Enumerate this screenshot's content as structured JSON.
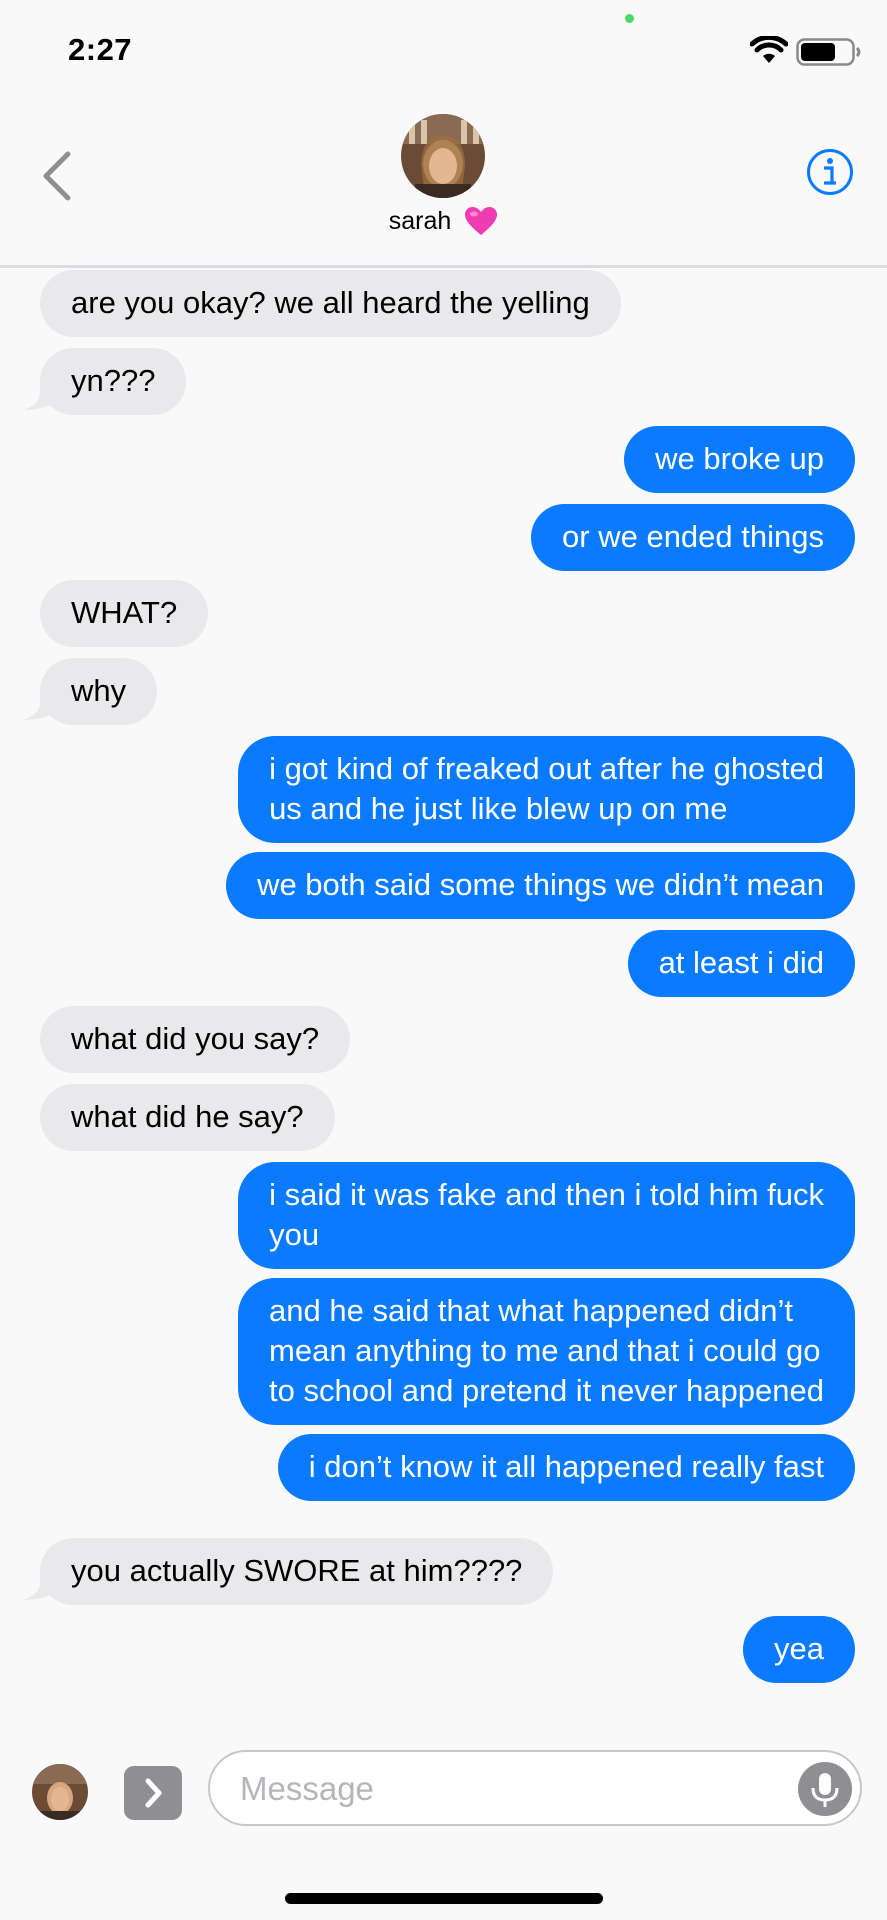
{
  "status_bar": {
    "time": "2:27"
  },
  "header": {
    "contact_name": "sarah",
    "back_icon": "chevron-left-icon",
    "info_icon": "info-circle-icon",
    "heart_emoji": "pink-heart-icon"
  },
  "messages": [
    {
      "from": "them",
      "text": "are you okay? we all heard the yelling"
    },
    {
      "from": "them",
      "text": "yn???"
    },
    {
      "from": "me",
      "text": "we broke up"
    },
    {
      "from": "me",
      "text": "or we ended things"
    },
    {
      "from": "them",
      "text": "WHAT?"
    },
    {
      "from": "them",
      "text": "why"
    },
    {
      "from": "me",
      "text": "i got kind of freaked out after he ghosted\nus and he just like blew up on me"
    },
    {
      "from": "me",
      "text": "we both said some things we didn’t mean"
    },
    {
      "from": "me",
      "text": "at least i did"
    },
    {
      "from": "them",
      "text": "what did you say?"
    },
    {
      "from": "them",
      "text": "what did he say?"
    },
    {
      "from": "me",
      "text": "i said it was fake and then i told him fuck\nyou"
    },
    {
      "from": "me",
      "text": "and he said that what happened didn’t\nmean anything to me and that i could go\nto school and pretend it never happened"
    },
    {
      "from": "me",
      "text": "i don’t know it all happened really fast"
    },
    {
      "from": "them",
      "text": "you actually SWORE at him????"
    },
    {
      "from": "me",
      "text": "yea"
    }
  ],
  "input": {
    "placeholder": "Message"
  },
  "colors": {
    "outgoing": "#0a7bff",
    "incoming": "#e9e9eb",
    "accent": "#0a7bff"
  }
}
